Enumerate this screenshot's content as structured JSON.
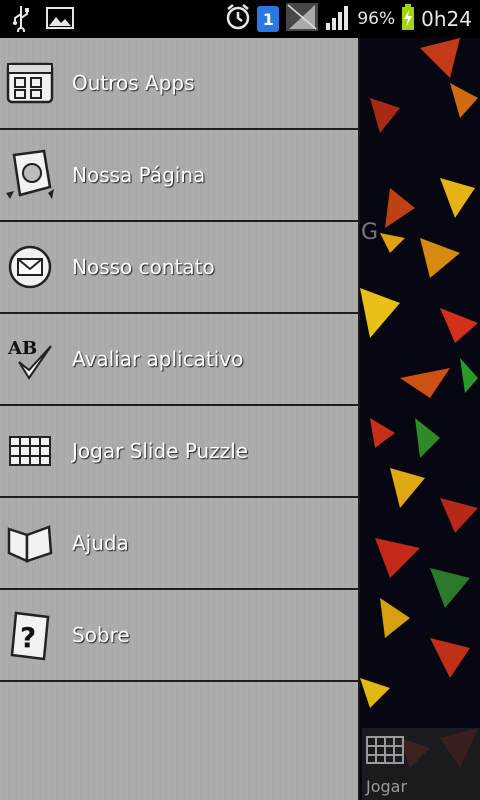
{
  "status_bar": {
    "battery_percent": "96%",
    "time": "0h24",
    "sim_slot": "1",
    "icons": [
      "usb-icon",
      "image-icon",
      "alarm-icon",
      "sim-icon",
      "no-signal-icon",
      "signal-icon",
      "battery-charging-icon"
    ]
  },
  "drawer": {
    "items": [
      {
        "label": "Outros Apps",
        "icon": "apps-grid-icon"
      },
      {
        "label": "Nossa Página",
        "icon": "globe-page-icon"
      },
      {
        "label": "Nosso contato",
        "icon": "mail-icon"
      },
      {
        "label": "Avaliar aplicativo",
        "icon": "rate-ab-check-icon"
      },
      {
        "label": "Jogar Slide Puzzle",
        "icon": "puzzle-grid-icon"
      },
      {
        "label": "Ajuda",
        "icon": "book-icon"
      },
      {
        "label": "Sobre",
        "icon": "question-icon"
      }
    ]
  },
  "background": {
    "play_label": "Jogar",
    "ghost_text": "G"
  },
  "colors": {
    "drawer_bg": "#acacac",
    "divider": "#1f1f1f",
    "sim_badge": "#2a78e4",
    "battery": "#9fd500"
  }
}
